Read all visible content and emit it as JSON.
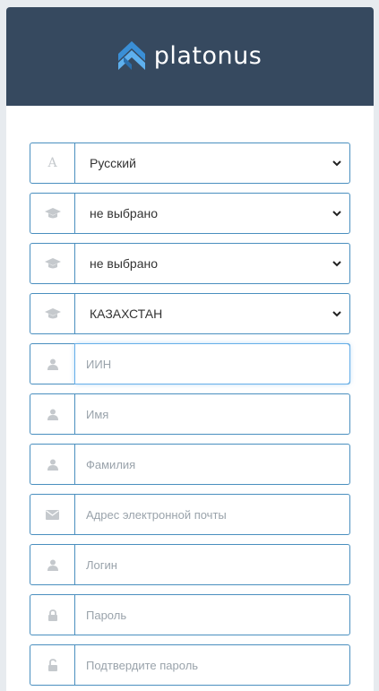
{
  "brand": {
    "name": "platonus"
  },
  "form": {
    "language": {
      "icon": "font-icon",
      "glyph": "A",
      "value": "Русский"
    },
    "select1": {
      "icon": "graduation-cap-icon",
      "value": "не выбрано"
    },
    "select2": {
      "icon": "graduation-cap-icon",
      "value": "не выбрано"
    },
    "country": {
      "icon": "graduation-cap-icon",
      "value": "КАЗАХСТАН"
    },
    "iin": {
      "icon": "user-icon",
      "placeholder": "ИИН"
    },
    "first_name": {
      "icon": "user-icon",
      "placeholder": "Имя"
    },
    "last_name": {
      "icon": "user-icon",
      "placeholder": "Фамилия"
    },
    "email": {
      "icon": "envelope-icon",
      "placeholder": "Адрес электронной почты"
    },
    "login": {
      "icon": "user-icon",
      "placeholder": "Логин"
    },
    "password": {
      "icon": "lock-icon",
      "placeholder": "Пароль"
    },
    "confirm_password": {
      "icon": "unlock-icon",
      "placeholder": "Подтвердите пароль"
    }
  },
  "colors": {
    "header_bg": "#36495f",
    "page_bg": "#e7ebef",
    "field_border": "#4a8fbf",
    "focus_glow": "#66afe9",
    "icon_gray": "#c5c9cd",
    "logo_blue": "#3a8fd6"
  }
}
